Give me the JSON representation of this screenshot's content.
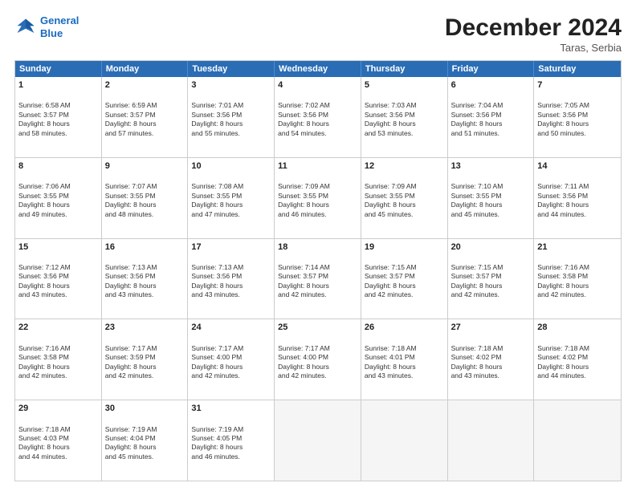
{
  "header": {
    "logo_line1": "General",
    "logo_line2": "Blue",
    "title": "December 2024",
    "subtitle": "Taras, Serbia"
  },
  "days_of_week": [
    "Sunday",
    "Monday",
    "Tuesday",
    "Wednesday",
    "Thursday",
    "Friday",
    "Saturday"
  ],
  "weeks": [
    [
      {
        "day": "1",
        "lines": [
          "Sunrise: 6:58 AM",
          "Sunset: 3:57 PM",
          "Daylight: 8 hours",
          "and 58 minutes."
        ]
      },
      {
        "day": "2",
        "lines": [
          "Sunrise: 6:59 AM",
          "Sunset: 3:57 PM",
          "Daylight: 8 hours",
          "and 57 minutes."
        ]
      },
      {
        "day": "3",
        "lines": [
          "Sunrise: 7:01 AM",
          "Sunset: 3:56 PM",
          "Daylight: 8 hours",
          "and 55 minutes."
        ]
      },
      {
        "day": "4",
        "lines": [
          "Sunrise: 7:02 AM",
          "Sunset: 3:56 PM",
          "Daylight: 8 hours",
          "and 54 minutes."
        ]
      },
      {
        "day": "5",
        "lines": [
          "Sunrise: 7:03 AM",
          "Sunset: 3:56 PM",
          "Daylight: 8 hours",
          "and 53 minutes."
        ]
      },
      {
        "day": "6",
        "lines": [
          "Sunrise: 7:04 AM",
          "Sunset: 3:56 PM",
          "Daylight: 8 hours",
          "and 51 minutes."
        ]
      },
      {
        "day": "7",
        "lines": [
          "Sunrise: 7:05 AM",
          "Sunset: 3:56 PM",
          "Daylight: 8 hours",
          "and 50 minutes."
        ]
      }
    ],
    [
      {
        "day": "8",
        "lines": [
          "Sunrise: 7:06 AM",
          "Sunset: 3:55 PM",
          "Daylight: 8 hours",
          "and 49 minutes."
        ]
      },
      {
        "day": "9",
        "lines": [
          "Sunrise: 7:07 AM",
          "Sunset: 3:55 PM",
          "Daylight: 8 hours",
          "and 48 minutes."
        ]
      },
      {
        "day": "10",
        "lines": [
          "Sunrise: 7:08 AM",
          "Sunset: 3:55 PM",
          "Daylight: 8 hours",
          "and 47 minutes."
        ]
      },
      {
        "day": "11",
        "lines": [
          "Sunrise: 7:09 AM",
          "Sunset: 3:55 PM",
          "Daylight: 8 hours",
          "and 46 minutes."
        ]
      },
      {
        "day": "12",
        "lines": [
          "Sunrise: 7:09 AM",
          "Sunset: 3:55 PM",
          "Daylight: 8 hours",
          "and 45 minutes."
        ]
      },
      {
        "day": "13",
        "lines": [
          "Sunrise: 7:10 AM",
          "Sunset: 3:55 PM",
          "Daylight: 8 hours",
          "and 45 minutes."
        ]
      },
      {
        "day": "14",
        "lines": [
          "Sunrise: 7:11 AM",
          "Sunset: 3:56 PM",
          "Daylight: 8 hours",
          "and 44 minutes."
        ]
      }
    ],
    [
      {
        "day": "15",
        "lines": [
          "Sunrise: 7:12 AM",
          "Sunset: 3:56 PM",
          "Daylight: 8 hours",
          "and 43 minutes."
        ]
      },
      {
        "day": "16",
        "lines": [
          "Sunrise: 7:13 AM",
          "Sunset: 3:56 PM",
          "Daylight: 8 hours",
          "and 43 minutes."
        ]
      },
      {
        "day": "17",
        "lines": [
          "Sunrise: 7:13 AM",
          "Sunset: 3:56 PM",
          "Daylight: 8 hours",
          "and 43 minutes."
        ]
      },
      {
        "day": "18",
        "lines": [
          "Sunrise: 7:14 AM",
          "Sunset: 3:57 PM",
          "Daylight: 8 hours",
          "and 42 minutes."
        ]
      },
      {
        "day": "19",
        "lines": [
          "Sunrise: 7:15 AM",
          "Sunset: 3:57 PM",
          "Daylight: 8 hours",
          "and 42 minutes."
        ]
      },
      {
        "day": "20",
        "lines": [
          "Sunrise: 7:15 AM",
          "Sunset: 3:57 PM",
          "Daylight: 8 hours",
          "and 42 minutes."
        ]
      },
      {
        "day": "21",
        "lines": [
          "Sunrise: 7:16 AM",
          "Sunset: 3:58 PM",
          "Daylight: 8 hours",
          "and 42 minutes."
        ]
      }
    ],
    [
      {
        "day": "22",
        "lines": [
          "Sunrise: 7:16 AM",
          "Sunset: 3:58 PM",
          "Daylight: 8 hours",
          "and 42 minutes."
        ]
      },
      {
        "day": "23",
        "lines": [
          "Sunrise: 7:17 AM",
          "Sunset: 3:59 PM",
          "Daylight: 8 hours",
          "and 42 minutes."
        ]
      },
      {
        "day": "24",
        "lines": [
          "Sunrise: 7:17 AM",
          "Sunset: 4:00 PM",
          "Daylight: 8 hours",
          "and 42 minutes."
        ]
      },
      {
        "day": "25",
        "lines": [
          "Sunrise: 7:17 AM",
          "Sunset: 4:00 PM",
          "Daylight: 8 hours",
          "and 42 minutes."
        ]
      },
      {
        "day": "26",
        "lines": [
          "Sunrise: 7:18 AM",
          "Sunset: 4:01 PM",
          "Daylight: 8 hours",
          "and 43 minutes."
        ]
      },
      {
        "day": "27",
        "lines": [
          "Sunrise: 7:18 AM",
          "Sunset: 4:02 PM",
          "Daylight: 8 hours",
          "and 43 minutes."
        ]
      },
      {
        "day": "28",
        "lines": [
          "Sunrise: 7:18 AM",
          "Sunset: 4:02 PM",
          "Daylight: 8 hours",
          "and 44 minutes."
        ]
      }
    ],
    [
      {
        "day": "29",
        "lines": [
          "Sunrise: 7:18 AM",
          "Sunset: 4:03 PM",
          "Daylight: 8 hours",
          "and 44 minutes."
        ]
      },
      {
        "day": "30",
        "lines": [
          "Sunrise: 7:19 AM",
          "Sunset: 4:04 PM",
          "Daylight: 8 hours",
          "and 45 minutes."
        ]
      },
      {
        "day": "31",
        "lines": [
          "Sunrise: 7:19 AM",
          "Sunset: 4:05 PM",
          "Daylight: 8 hours",
          "and 46 minutes."
        ]
      },
      null,
      null,
      null,
      null
    ]
  ]
}
